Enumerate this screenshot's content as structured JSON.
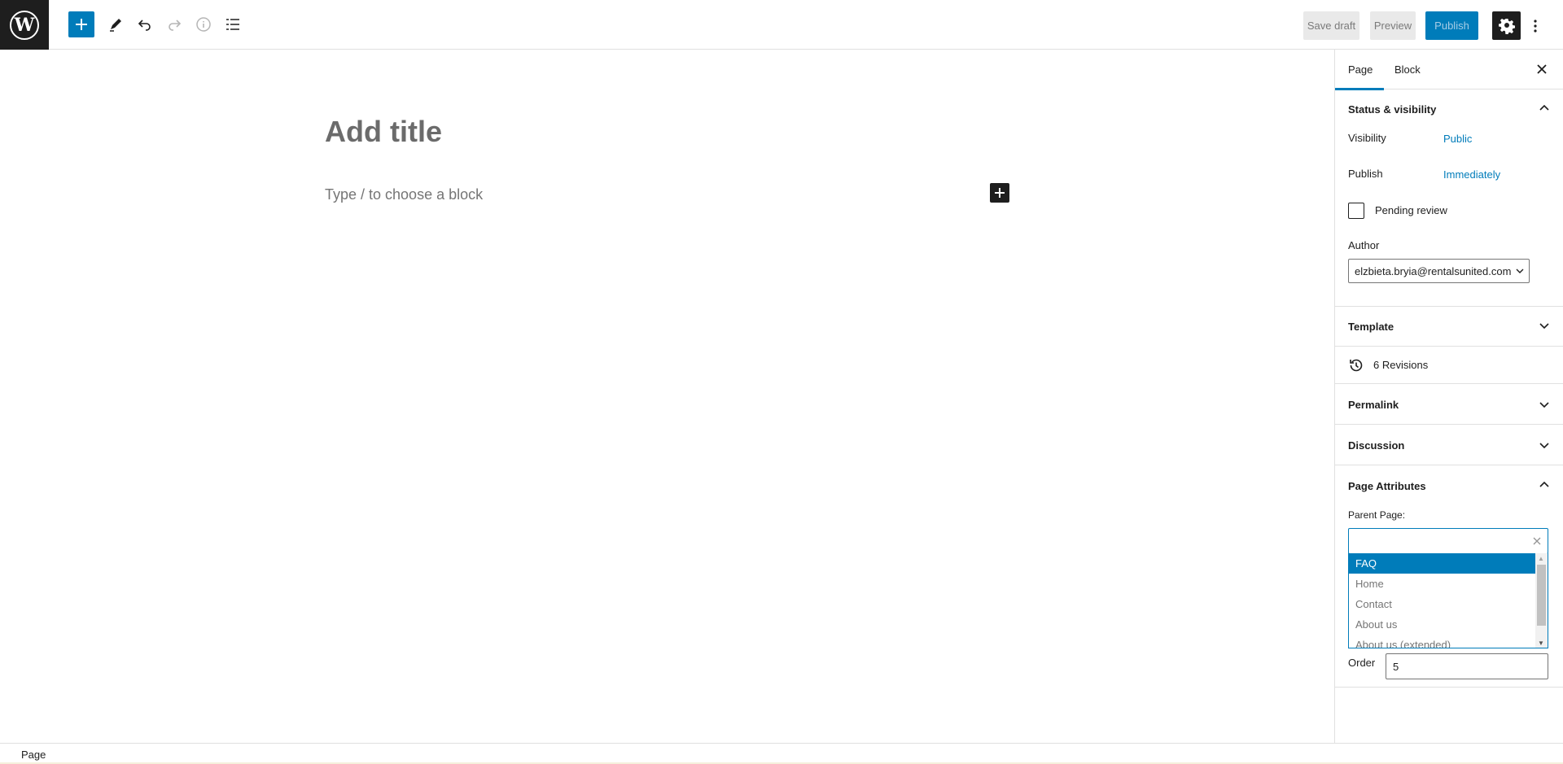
{
  "toolbar": {
    "save_draft": "Save draft",
    "preview": "Preview",
    "publish": "Publish"
  },
  "editor": {
    "title_placeholder": "Add title",
    "block_placeholder": "Type / to choose a block"
  },
  "sidebar": {
    "tabs": [
      "Page",
      "Block"
    ],
    "status": {
      "heading": "Status & visibility",
      "visibility_label": "Visibility",
      "visibility_value": "Public",
      "publish_label": "Publish",
      "publish_value": "Immediately",
      "pending_review": "Pending review",
      "author_label": "Author",
      "author_value": "elzbieta.bryia@rentalsunited.com"
    },
    "template": "Template",
    "revisions": "6 Revisions",
    "permalink": "Permalink",
    "discussion": "Discussion",
    "page_attributes": {
      "heading": "Page Attributes",
      "parent_label": "Parent Page:",
      "options": [
        "FAQ",
        "Home",
        "Contact",
        "About us",
        "About us (extended)"
      ],
      "order_label": "Order",
      "order_value": "5"
    }
  },
  "footer": {
    "breadcrumb": "Page"
  },
  "colors": {
    "accent": "#007cba",
    "dark": "#1e1e1e"
  }
}
